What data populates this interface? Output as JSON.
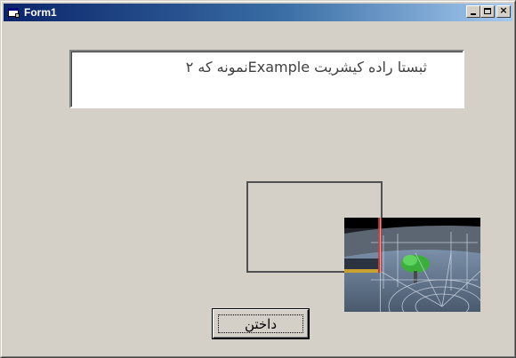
{
  "window": {
    "title": "Form1",
    "icon": "form-app-icon",
    "caption_buttons": [
      "minimize-icon",
      "maximize-icon",
      "close-icon"
    ],
    "close_glyph": "×"
  },
  "textbox": {
    "value": "ثبستا راده كيشريت Exampleنمونه كه ٢"
  },
  "picture": {
    "description_icon": "3d-scene-picture"
  },
  "button": {
    "label": "داختن"
  },
  "colors": {
    "titlebar_start": "#0a246a",
    "titlebar_end": "#a6caf0",
    "face": "#d4d0c8"
  }
}
